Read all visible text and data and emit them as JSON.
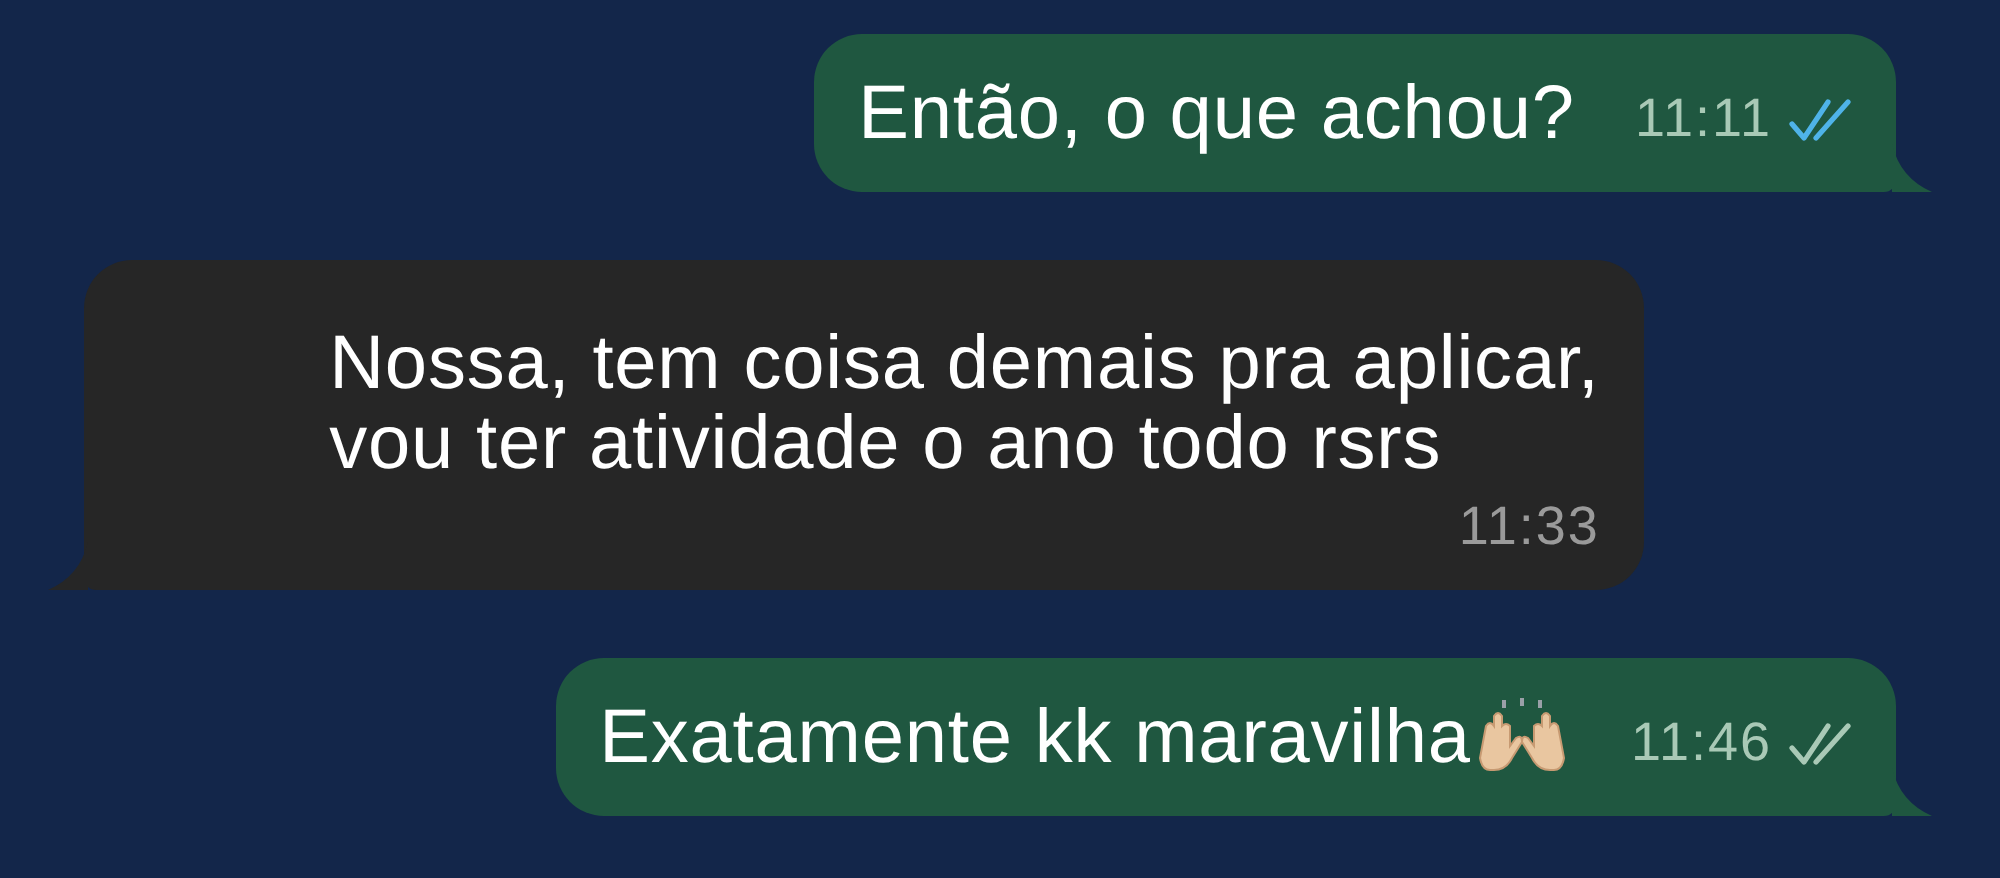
{
  "messages": [
    {
      "kind": "outgoing",
      "text": "Então, o que achou?",
      "time": "11:11",
      "read": true
    },
    {
      "kind": "incoming",
      "text": "Nossa, tem coisa demais pra aplicar,\nvou ter atividade o ano todo rsrs",
      "time": "11:33"
    },
    {
      "kind": "outgoing",
      "text": "Exatamente kk maravilha",
      "time": "11:46",
      "read": false,
      "emoji": true
    }
  ]
}
